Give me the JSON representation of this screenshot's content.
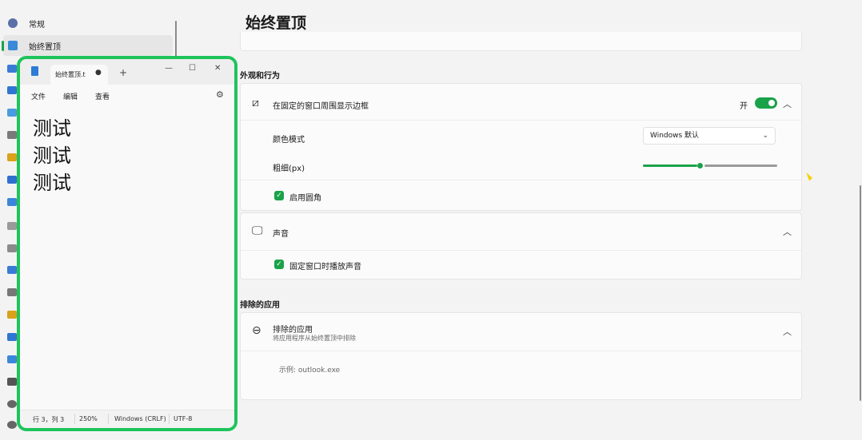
{
  "sidebar": {
    "items": [
      {
        "label": "常规",
        "color": "#5b6fa8"
      },
      {
        "label": "始终置顶",
        "color": "#3a8ad8"
      }
    ],
    "icon_colors": [
      "#3a7bd5",
      "#2f76d2",
      "#4b9be0",
      "#7a7a7a",
      "#d9a21b",
      "#2f6fd0",
      "#3c86d9",
      "#9a9a9a",
      "#8b8b8b",
      "#3a7bd5",
      "#777777",
      "#d9a21b",
      "#2f76d2",
      "#3b88db",
      "#555555",
      "#666666"
    ]
  },
  "main": {
    "title": "始终置顶",
    "section_appearance": "外观和行为",
    "border_row": {
      "label": "在固定的窗口周围显示边框",
      "toggle_text": "开",
      "enabled": true
    },
    "color_mode": {
      "label": "颜色模式",
      "value": "Windows 默认"
    },
    "thickness": {
      "label": "粗细(px)",
      "slider_fraction": 0.42
    },
    "rounded": {
      "label": "启用圆角",
      "checked": true
    },
    "sound": {
      "label": "声音"
    },
    "sound_check": {
      "label": "固定窗口时播放声音",
      "checked": true
    },
    "section_excluded": "排除的应用",
    "excluded": {
      "label": "排除的应用",
      "sub": "将应用程序从始终置顶中排除",
      "placeholder": "示例: outlook.exe"
    }
  },
  "notepad": {
    "tab_label": "始终置顶.t",
    "tab_dot": "●",
    "plus": "+",
    "minimize": "—",
    "maximize": "☐",
    "close": "✕",
    "menu": {
      "file": "文件",
      "edit": "编辑",
      "view": "查看"
    },
    "content_lines": [
      "测试",
      "测试",
      "测试"
    ],
    "status": {
      "position": "行 3，列 3",
      "zoom": "250%",
      "line_ending": "Windows (CRLF)",
      "encoding": "UTF-8"
    }
  },
  "colors": {
    "accent": "#1aa24a",
    "highlight_border": "#1ec45c"
  }
}
